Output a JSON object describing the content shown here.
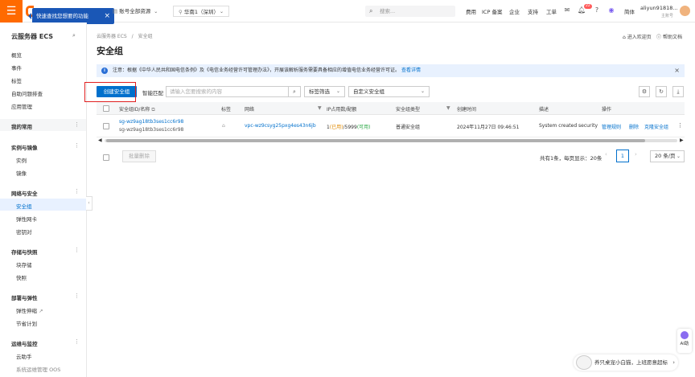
{
  "topbar": {
    "tooltip": "快速查找您想要的功能",
    "account_select": "账号全部资源",
    "region_select": "华南1（深圳）",
    "search_placeholder": "搜索...",
    "nav": [
      "费用",
      "ICP 备案",
      "企业",
      "支持",
      "工单"
    ],
    "notification_count": "22",
    "lang": "简体",
    "user_name": "aliyun91818...",
    "user_sub": "主账号"
  },
  "sidebar": {
    "title": "云服务器 ECS",
    "top_items": [
      "概览",
      "事件",
      "标签",
      "自助问题排查",
      "应用管理"
    ],
    "groups": [
      {
        "label": "我的常用",
        "items": []
      },
      {
        "label": "实例与镜像",
        "items": [
          "实例",
          "镜像"
        ]
      },
      {
        "label": "网络与安全",
        "items": [
          "安全组",
          "弹性网卡",
          "密钥对"
        ]
      },
      {
        "label": "存储与快照",
        "items": [
          "块存储",
          "快照"
        ]
      },
      {
        "label": "部署与弹性",
        "items": [
          "弹性伸缩",
          "节省计划"
        ]
      },
      {
        "label": "运维与监控",
        "items": [
          "云助手",
          "系统运维管理 OOS"
        ]
      }
    ]
  },
  "breadcrumb": {
    "root": "云服务器 ECS",
    "sep": "/",
    "current": "安全组"
  },
  "page": {
    "title": "安全组",
    "links": [
      "进入欢迎页",
      "帮助文档"
    ]
  },
  "notice": {
    "text": "注意：根据《中华人民共和国电信条例》及《电信业务经营许可管理办法》，开展该解析服务需要具备相应的增值电信业务经营许可证。",
    "link": "查看详情"
  },
  "toolbar": {
    "create": "创建安全组",
    "match_label": "智能匹配",
    "search_placeholder": "请输入您要搜索的内容",
    "tag_filter": "标签筛选",
    "custom_sg": "自定义安全组"
  },
  "table": {
    "headers": [
      "安全组ID/名称",
      "标签",
      "网络",
      "IP占用数/配额",
      "安全组类型",
      "创建时间",
      "描述",
      "操作"
    ],
    "rows": [
      {
        "id": "sg-wz9ag18tb3ses1cc6r98",
        "name": "sg-wz9ag18tb3ses1cc6r98",
        "network": "vpc-wz9csyg25pxg4es43n6jb",
        "ip_used": "1",
        "ip_used_label": "(已用)",
        "ip_quota": "/5999",
        "ip_avail_label": "(可用)",
        "type": "普通安全组",
        "created": "2024年11月27日 09:46:51",
        "desc": "System created security grou",
        "actions": [
          "管理规则",
          "删除",
          "克隆安全组"
        ]
      }
    ]
  },
  "footer": {
    "batch_delete": "批量删除",
    "page_info": "共有1条，每页显示：20条",
    "current_page": "1",
    "page_size": "20 条/页"
  },
  "float": {
    "ai_label": "AI助",
    "pet_text": "养只桌宠小白猫，上班愿意超标"
  },
  "colors": {
    "brand": "#ff6a00",
    "primary": "#0070cc",
    "highlight": "#e02020"
  }
}
